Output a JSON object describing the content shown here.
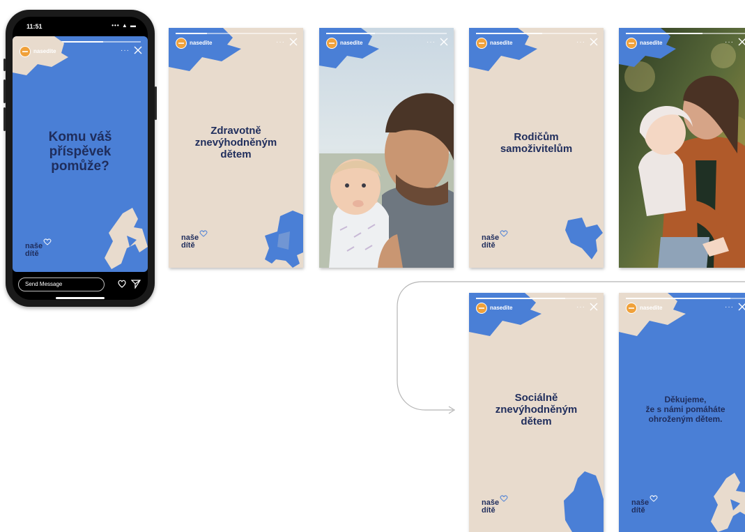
{
  "phone": {
    "time": "11:51",
    "status_icons": "••• ▲ ▬",
    "username": "nasedite",
    "headline": "Komu váš\npříspěvek\npomůže?",
    "logo_line1": "naše",
    "logo_line2": "dítě",
    "send_placeholder": "Send Message",
    "heart_icon": "heart-icon",
    "send_icon": "send-icon"
  },
  "stories": [
    {
      "username": "nasedite",
      "headline": "Zdravotně\nznevýhodněným\ndětem",
      "logo_line1": "naše",
      "logo_line2": "dítě",
      "shape": "stroller"
    },
    {
      "username": "nasedite",
      "photo": "father-with-baby"
    },
    {
      "username": "nasedite",
      "headline": "Rodičům\nsamoživitelům",
      "logo_line1": "naše",
      "logo_line2": "dítě",
      "shape": "bird"
    },
    {
      "username": "nasedite",
      "photo": "mother-kissing-child"
    },
    {
      "username": "nasedite",
      "headline": "Sociálně\nznevýhodněným\ndětem",
      "logo_line1": "naše",
      "logo_line2": "dítě",
      "shape": "house"
    },
    {
      "username": "nasedite",
      "headline": "Děkujeme,\nže s námi pomáháte\nohroženým dětem.",
      "logo_line1": "naše",
      "logo_line2": "dítě",
      "shape": "rocking-horse"
    }
  ],
  "icons": {
    "more": "···",
    "close": "close-icon"
  },
  "colors": {
    "blue": "#4a7fd6",
    "beige": "#e8dbcd",
    "navy": "#1f2d5c",
    "avatar": "#f0a13a"
  }
}
